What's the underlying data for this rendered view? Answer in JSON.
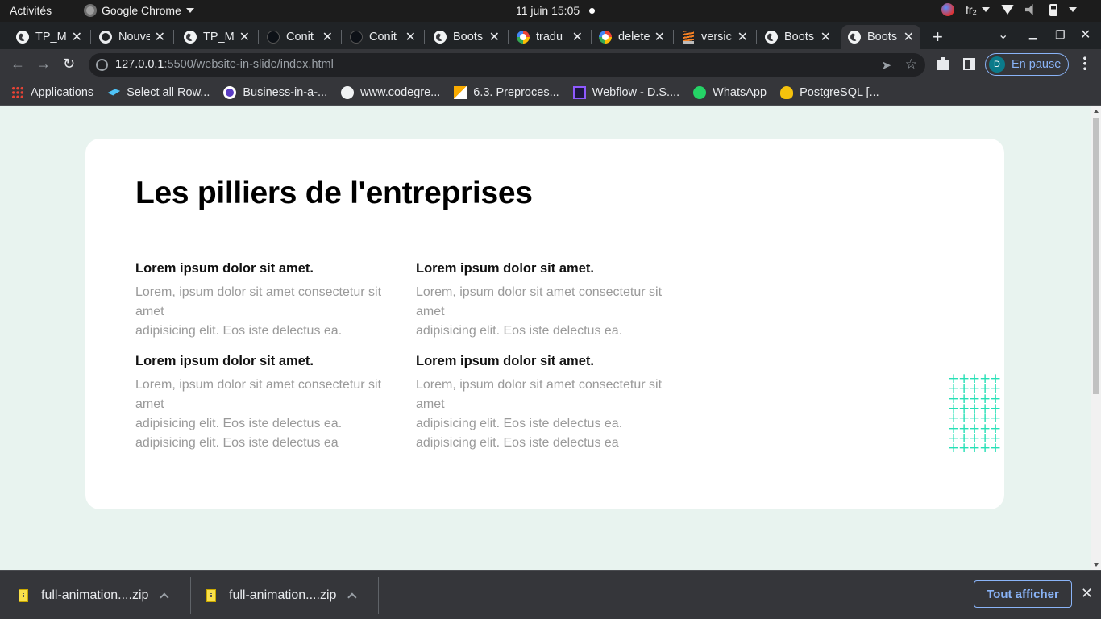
{
  "system_bar": {
    "activities": "Activités",
    "app_name": "Google Chrome",
    "datetime": "11 juin  15:05",
    "keyboard_layout": "fr₂"
  },
  "tabs": [
    {
      "title": "TP_M",
      "icon": "globe-icon"
    },
    {
      "title": "Nouve",
      "icon": "chrome-icon"
    },
    {
      "title": "TP_M",
      "icon": "globe-icon"
    },
    {
      "title": "Conit",
      "icon": "github-icon"
    },
    {
      "title": "Conit",
      "icon": "github-icon"
    },
    {
      "title": "Boots",
      "icon": "globe-icon"
    },
    {
      "title": "tradu",
      "icon": "google-icon"
    },
    {
      "title": "delete",
      "icon": "google-icon"
    },
    {
      "title": "versic",
      "icon": "stackoverflow-icon"
    },
    {
      "title": "Boots",
      "icon": "globe-icon"
    },
    {
      "title": "Boots",
      "icon": "globe-icon",
      "active": true
    }
  ],
  "toolbar": {
    "url_host": "127.0.0.1",
    "url_path": ":5500/website-in-slide/index.html",
    "profile_initial": "D",
    "profile_status": "En pause"
  },
  "bookmarks": [
    {
      "label": "Applications",
      "icon": "apps-grid-icon"
    },
    {
      "label": "Select all Row...",
      "icon": "bookmark-blue-icon"
    },
    {
      "label": "Business-in-a-...",
      "icon": "bizz-icon"
    },
    {
      "label": "www.codegre...",
      "icon": "globe-icon"
    },
    {
      "label": "6.3. Preproces...",
      "icon": "doc-icon"
    },
    {
      "label": "Webflow - D.S....",
      "icon": "webflow-icon"
    },
    {
      "label": "WhatsApp",
      "icon": "whatsapp-icon"
    },
    {
      "label": "PostgreSQL [...",
      "icon": "postgres-icon"
    }
  ],
  "page": {
    "title": "Les pilliers de l'entreprises",
    "items": [
      {
        "heading": "Lorem ipsum dolor sit amet.",
        "lines": [
          "Lorem, ipsum dolor sit amet consectetur sit amet",
          "adipisicing elit. Eos iste delectus ea."
        ]
      },
      {
        "heading": "Lorem ipsum dolor sit amet.",
        "lines": [
          "Lorem, ipsum dolor sit amet consectetur sit amet",
          "adipisicing elit. Eos iste delectus ea."
        ]
      },
      {
        "heading": "Lorem ipsum dolor sit amet.",
        "lines": [
          "Lorem, ipsum dolor sit amet consectetur sit amet",
          "adipisicing elit. Eos iste delectus ea.",
          "adipisicing elit. Eos iste delectus ea"
        ]
      },
      {
        "heading": "Lorem ipsum dolor sit amet.",
        "lines": [
          "Lorem, ipsum dolor sit amet consectetur sit amet",
          "adipisicing elit. Eos iste delectus ea.",
          "adipisicing elit. Eos iste delectus ea"
        ]
      }
    ],
    "accent_color": "#27e0b6"
  },
  "downloads": {
    "files": [
      {
        "name": "full-animation....zip"
      },
      {
        "name": "full-animation....zip"
      }
    ],
    "show_all": "Tout afficher"
  }
}
